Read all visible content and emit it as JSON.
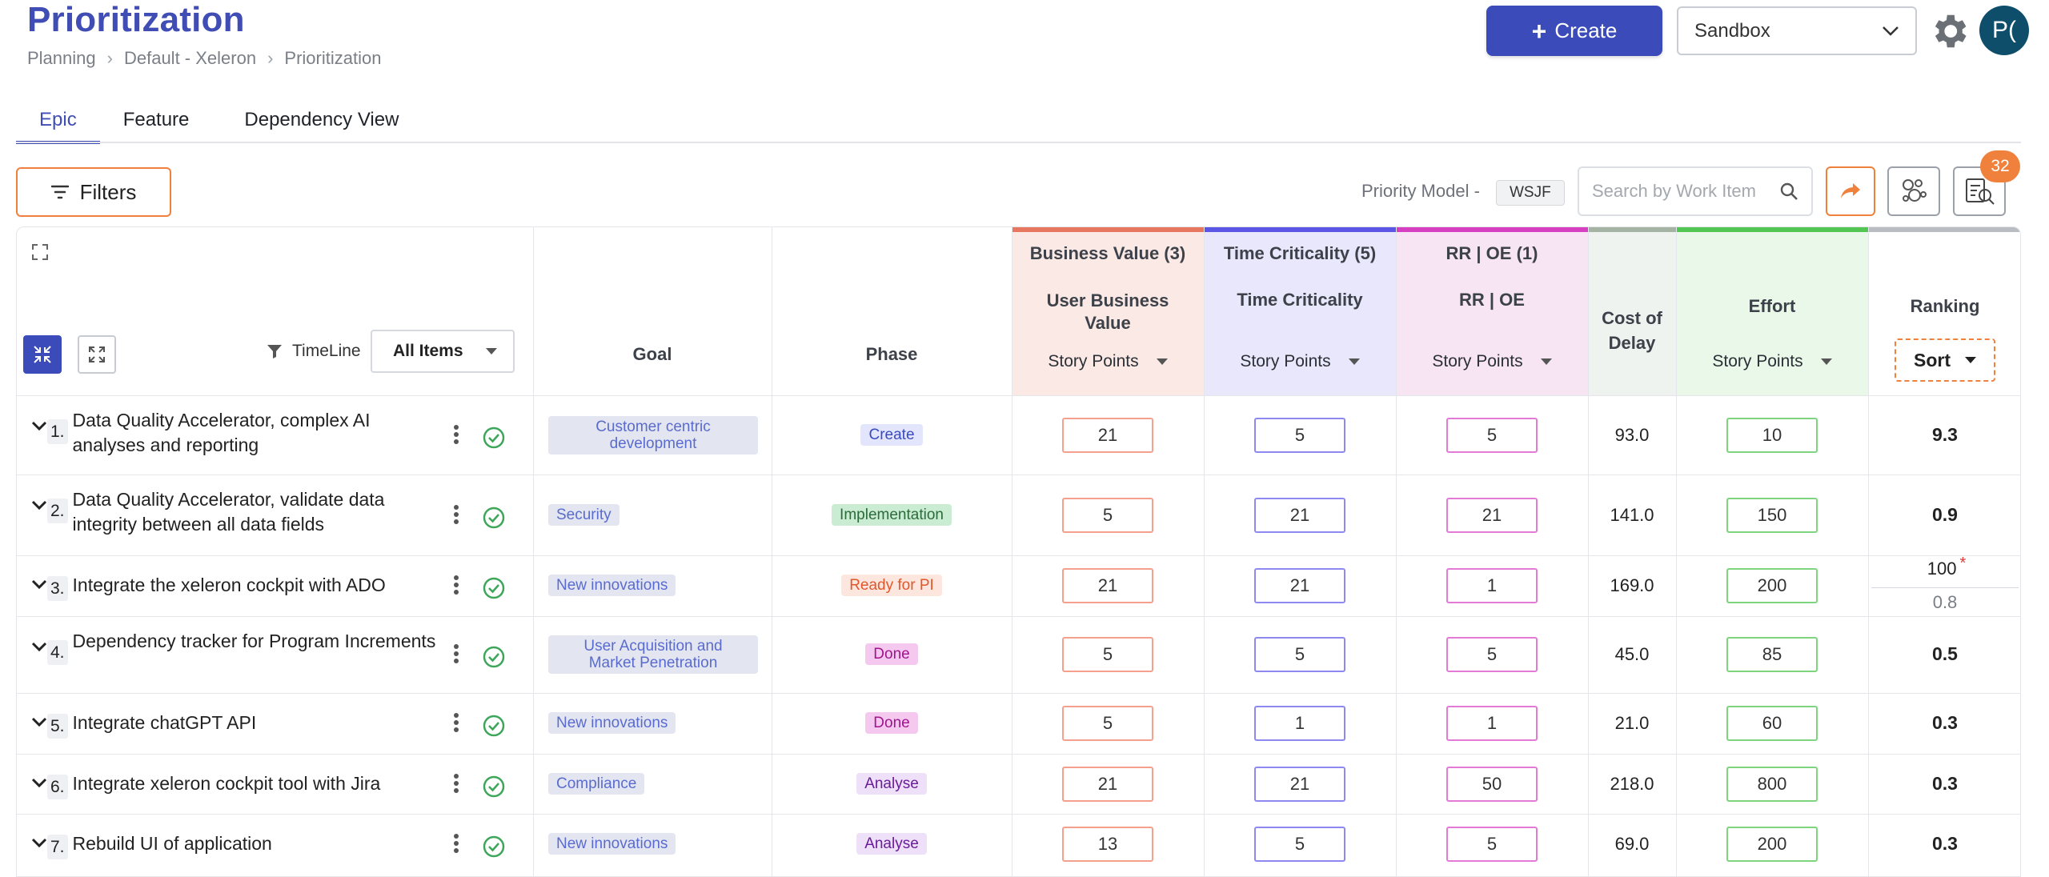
{
  "header": {
    "title": "Prioritization",
    "breadcrumb": [
      "Planning",
      "Default - Xeleron",
      "Prioritization"
    ],
    "create_label": "Create",
    "environment": "Sandbox",
    "avatar_initials": "P("
  },
  "tabs": [
    {
      "label": "Epic",
      "active": true
    },
    {
      "label": "Feature",
      "active": false
    },
    {
      "label": "Dependency View",
      "active": false
    }
  ],
  "toolbar": {
    "filters_label": "Filters",
    "priority_model_label": "Priority Model -",
    "priority_model_value": "WSJF",
    "search_placeholder": "Search by Work Item",
    "notification_count": "32"
  },
  "grid": {
    "timeline_label": "TimeLine",
    "timeline_value": "All Items",
    "columns": {
      "goal": "Goal",
      "phase": "Phase",
      "bv_group": "Business Value (3)",
      "bv_sub": "User Business Value",
      "tc_group": "Time Criticality (5)",
      "tc_sub": "Time Criticality",
      "rr_group": "RR | OE (1)",
      "rr_sub": "RR | OE",
      "cod": "Cost of Delay",
      "effort": "Effort",
      "ranking": "Ranking",
      "unit": "Story Points",
      "sort_label": "Sort"
    },
    "colors": {
      "bv": "#e8775f",
      "tc": "#5b56e6",
      "rr": "#d73fc2",
      "cod": "#a5b3a5",
      "effort": "#53c552",
      "ranking": "#b9bcc1"
    },
    "rows": [
      {
        "num": "1.",
        "title": "Data Quality Accelerator, complex AI analyses and reporting",
        "goal": "Customer centric development",
        "phase": "Create",
        "bv": "21",
        "tc": "5",
        "rr": "5",
        "cod": "93.0",
        "effort": "10",
        "ranking": "9.3"
      },
      {
        "num": "2.",
        "title": "Data Quality Accelerator, validate data integrity between all data fields",
        "goal": "Security",
        "phase": "Implementation",
        "bv": "5",
        "tc": "21",
        "rr": "21",
        "cod": "141.0",
        "effort": "150",
        "ranking": "0.9"
      },
      {
        "num": "3.",
        "title": "Integrate the xeleron cockpit with ADO",
        "goal": "New innovations",
        "phase": "Ready for PI",
        "bv": "21",
        "tc": "21",
        "rr": "1",
        "cod": "169.0",
        "effort": "200",
        "ranking_override": "100",
        "ranking": "0.8"
      },
      {
        "num": "4.",
        "title": "Dependency tracker for Program Increments",
        "goal": "User Acquisition and Market Penetration",
        "phase": "Done",
        "bv": "5",
        "tc": "5",
        "rr": "5",
        "cod": "45.0",
        "effort": "85",
        "ranking": "0.5"
      },
      {
        "num": "5.",
        "title": "Integrate chatGPT API",
        "goal": "New innovations",
        "phase": "Done",
        "bv": "5",
        "tc": "1",
        "rr": "1",
        "cod": "21.0",
        "effort": "60",
        "ranking": "0.3"
      },
      {
        "num": "6.",
        "title": "Integrate xeleron cockpit tool with Jira",
        "goal": "Compliance",
        "phase": "Analyse",
        "bv": "21",
        "tc": "21",
        "rr": "50",
        "cod": "218.0",
        "effort": "800",
        "ranking": "0.3"
      },
      {
        "num": "7.",
        "title": "Rebuild UI of application",
        "goal": "New innovations",
        "phase": "Analyse",
        "bv": "13",
        "tc": "5",
        "rr": "5",
        "cod": "69.0",
        "effort": "200",
        "ranking": "0.3"
      }
    ]
  }
}
